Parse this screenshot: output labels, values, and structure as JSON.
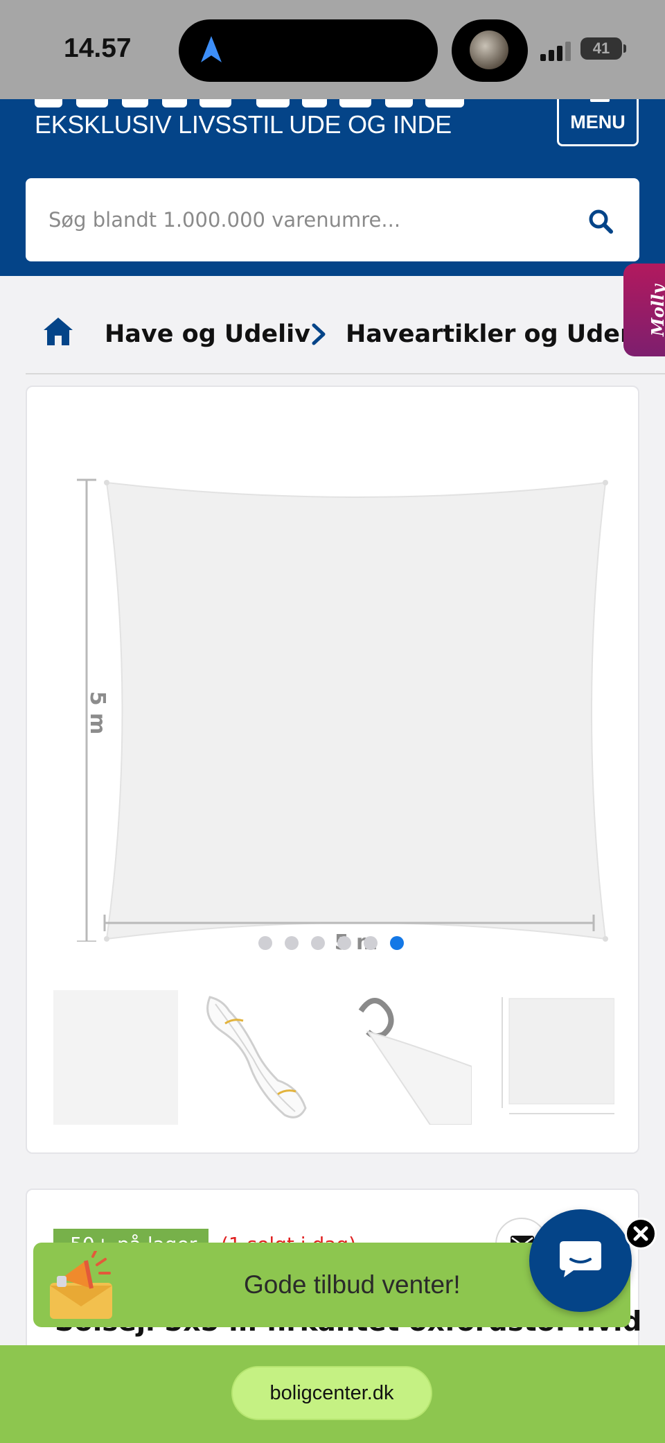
{
  "status_bar": {
    "time": "14.57",
    "battery": "41"
  },
  "header": {
    "tagline": "EKSKLUSIV LIVSSTIL UDE OG INDE",
    "menu_label": "MENU",
    "brand_color": "#044488"
  },
  "search": {
    "placeholder": "Søg blandt 1.000.000 varenumre..."
  },
  "side_tab": {
    "label": "Molly"
  },
  "breadcrumb": {
    "items": [
      {
        "label": "Have og Udeliv"
      },
      {
        "label": "Haveartikler og Udemiljø"
      }
    ]
  },
  "gallery": {
    "dimension_height": "5 m",
    "dimension_width": "5 m",
    "slide_count": 6,
    "active_slide": 6,
    "thumbnails": [
      "sail-front",
      "rope-coil",
      "d-ring-corner",
      "sail-dimensions"
    ]
  },
  "product": {
    "stock": "50+ på lager",
    "sold_today": "(1 solgt i dag)",
    "title": "Solsejl 5x5 m firkantet oxfordstof hvid"
  },
  "offer": {
    "text": "Gode tilbud venter!",
    "accent": "#8dc64f"
  },
  "browser": {
    "url": "boligcenter.dk"
  }
}
